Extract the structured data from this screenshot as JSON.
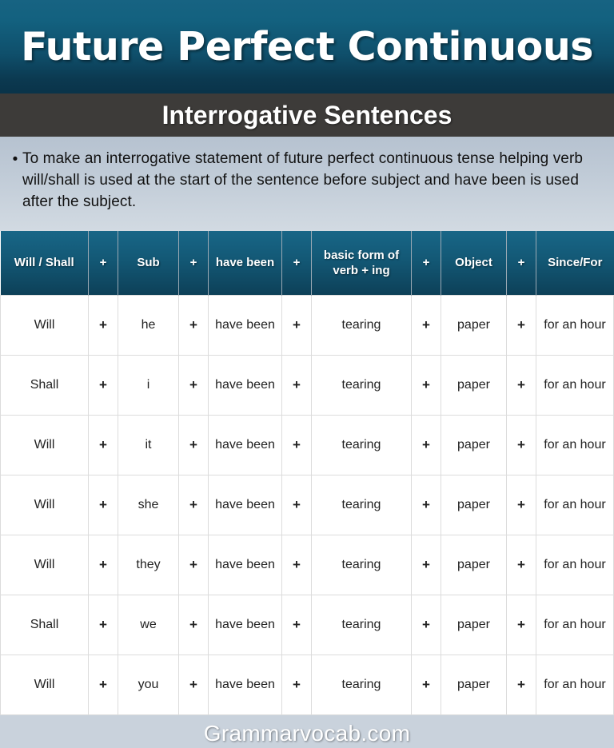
{
  "header": {
    "title": "Future Perfect Continuous",
    "subtitle": "Interrogative Sentences"
  },
  "description": {
    "bullet_glyph": "•",
    "text": "To make an interrogative statement of future perfect continuous tense helping verb will/shall is used at the start of the sentence before subject and have been is used after the subject."
  },
  "table": {
    "columns": [
      "Will / Shall",
      "+",
      "Sub",
      "+",
      "have been",
      "+",
      "basic form of verb + ing",
      "+",
      "Object",
      "+",
      "Since/For"
    ],
    "rows": [
      [
        "Will",
        "+",
        "he",
        "+",
        "have been",
        "+",
        "tearing",
        "+",
        "paper",
        "+",
        "for an hour"
      ],
      [
        "Shall",
        "+",
        "i",
        "+",
        "have been",
        "+",
        "tearing",
        "+",
        "paper",
        "+",
        "for an hour"
      ],
      [
        "Will",
        "+",
        "it",
        "+",
        "have been",
        "+",
        "tearing",
        "+",
        "paper",
        "+",
        "for an hour"
      ],
      [
        "Will",
        "+",
        "she",
        "+",
        "have been",
        "+",
        "tearing",
        "+",
        "paper",
        "+",
        "for an hour"
      ],
      [
        "Will",
        "+",
        "they",
        "+",
        "have been",
        "+",
        "tearing",
        "+",
        "paper",
        "+",
        "for an hour"
      ],
      [
        "Shall",
        "+",
        "we",
        "+",
        "have been",
        "+",
        "tearing",
        "+",
        "paper",
        "+",
        "for an hour"
      ],
      [
        "Will",
        "+",
        "you",
        "+",
        "have been",
        "+",
        "tearing",
        "+",
        "paper",
        "+",
        "for an hour"
      ]
    ]
  },
  "footer": {
    "site": "Grammarvocab.com"
  },
  "colors": {
    "header_blue_top": "#176382",
    "header_blue_bottom": "#0a3349",
    "subtitle_gray": "#3d3b39",
    "description_bg_top": "#b6c2d0",
    "description_bg_bottom": "#d2dae2",
    "table_header_blue": "#135875",
    "cell_border": "#dcdcdc",
    "footer_blue": "#0c4865",
    "text_dark": "#222222",
    "text_light": "#ffffff"
  }
}
